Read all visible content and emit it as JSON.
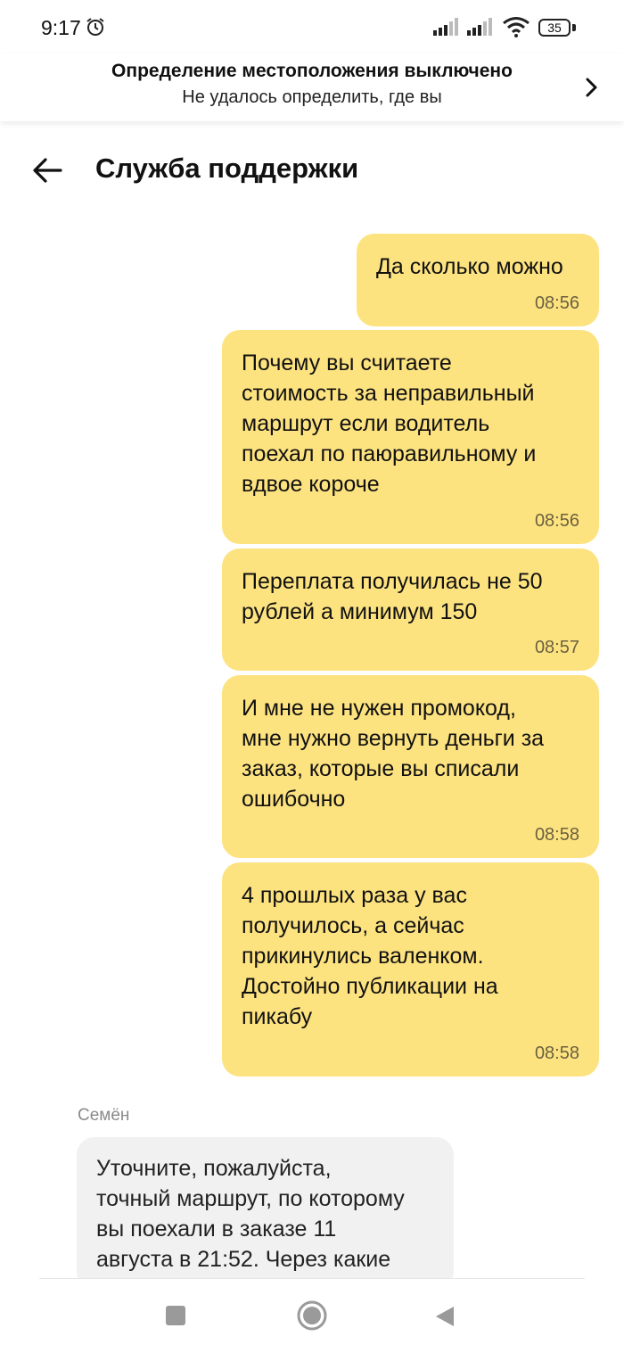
{
  "status_bar": {
    "time": "9:17",
    "battery": "35"
  },
  "location_banner": {
    "title": "Определение местоположения выключено",
    "subtitle": "Не удалось определить, где вы"
  },
  "header": {
    "title": "Служба поддержки"
  },
  "messages": [
    {
      "text": "Да сколько можно",
      "time": "08:56"
    },
    {
      "text": "Почему вы считаете\nстоимость за неправильный\nмаршрут если водитель\nпоехал по паюравильному и\nвдвое короче",
      "time": "08:56"
    },
    {
      "text": "Переплата получилась не 50\nрублей а минимум 150",
      "time": "08:57"
    },
    {
      "text": "И мне не нужен промокод,\nмне нужно вернуть деньги за\nзаказ, которые вы списали\nошибочно",
      "time": "08:58"
    },
    {
      "text": "4 прошлых раза у вас\nполучилось, а сейчас\nприкинулись валенком.\nДостойно публикации на\nпикабу",
      "time": "08:58"
    }
  ],
  "incoming": {
    "sender": "Семён",
    "text": "Уточните, пожалуйста,\nточный маршрут, по которому\nвы поехали в заказе 11\nавгуста в 21:52. Через какие"
  },
  "colors": {
    "outgoing_bubble": "#fde380",
    "incoming_bubble": "#f1f1f1"
  },
  "icons": [
    "alarm-icon",
    "signal-icon",
    "wifi-icon",
    "battery-icon",
    "chevron-right-icon",
    "back-arrow-icon",
    "recents-icon",
    "home-icon",
    "back-icon"
  ]
}
